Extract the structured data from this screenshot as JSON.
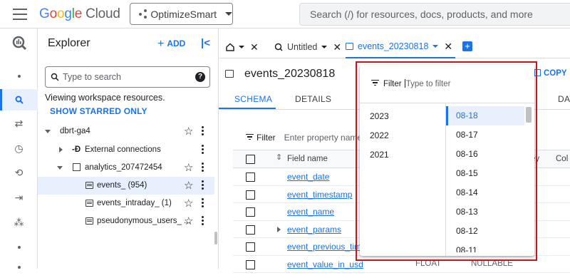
{
  "topbar": {
    "logo_google": [
      "G",
      "o",
      "o",
      "g",
      "l",
      "e"
    ],
    "logo_cloud": "Cloud",
    "project": "OptimizeSmart",
    "search_placeholder": "Search (/) for resources, docs, products, and more"
  },
  "explorer": {
    "title": "Explorer",
    "add_label": "ADD",
    "search_placeholder": "Type to search",
    "viewing_text": "Viewing workspace resources.",
    "starred_link": "SHOW STARRED ONLY",
    "tree": [
      {
        "label": "dbrt-ga4",
        "level": 0,
        "expanded": true
      },
      {
        "label": "External connections",
        "level": 1,
        "expanded": false
      },
      {
        "label": "analytics_207472454",
        "level": 1,
        "expanded": true
      },
      {
        "label": "events_ (954)",
        "level": 2,
        "selected": true
      },
      {
        "label": "events_intraday_ (1)",
        "level": 2
      },
      {
        "label": "pseudonymous_users_ ...",
        "level": 2
      }
    ]
  },
  "tabs": [
    {
      "label": "",
      "icon": "home-icon"
    },
    {
      "label": "Untitled",
      "icon": "query-icon"
    },
    {
      "label": "events_20230818",
      "icon": "table-icon",
      "active": true
    }
  ],
  "main": {
    "title": "events_20230818",
    "copy_label": "COPY",
    "subtabs": [
      "SCHEMA",
      "DETAILS",
      "DAT"
    ],
    "filter_label": "Filter",
    "filter_placeholder": "Enter property name",
    "column_field_name": "Field name",
    "column_key": "ey",
    "column_col": "Col",
    "fields": [
      {
        "name": "event_date",
        "type": "",
        "mode": ""
      },
      {
        "name": "event_timestamp",
        "type": "",
        "mode": ""
      },
      {
        "name": "event_name",
        "type": "",
        "mode": ""
      },
      {
        "name": "event_params",
        "type": "",
        "mode": "",
        "expandable": true
      },
      {
        "name": "event_previous_times",
        "type": "",
        "mode": ""
      },
      {
        "name": "event_value_in_usd",
        "type": "FLOAT",
        "mode": "NULLABLE"
      }
    ]
  },
  "popup": {
    "filter_label": "Filter",
    "filter_placeholder": "Type to filter",
    "years": [
      "2023",
      "2022",
      "2021"
    ],
    "days": [
      "08-18",
      "08-17",
      "08-16",
      "08-15",
      "08-14",
      "08-13",
      "08-12",
      "08-11"
    ],
    "selected_day": "08-18"
  },
  "colors": {
    "accent": "#1a73e8",
    "highlight": "#d0111a",
    "selected_bg": "#e8f0fe"
  }
}
